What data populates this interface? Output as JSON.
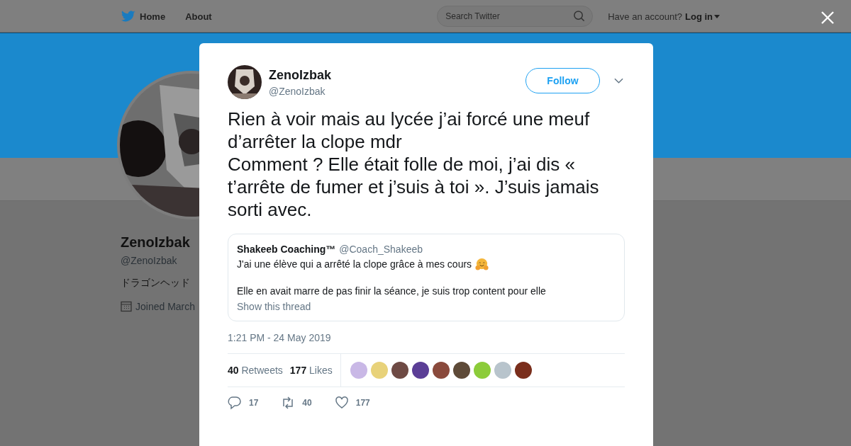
{
  "nav": {
    "items": [
      "Home",
      "About"
    ],
    "search": {
      "placeholder": "Search Twitter"
    },
    "account_prompt": "Have an account?",
    "login": "Log in"
  },
  "profile": {
    "name": "ZenoIzbak",
    "handle": "@ZenoIzbak",
    "bio": "ドラゴンヘッド",
    "joined": "Joined March"
  },
  "tweet": {
    "author": "ZenoIzbak",
    "handle": "@ZenoIzbak",
    "follow": "Follow",
    "text": "Rien à voir mais au lycée j’ai forcé une meuf d’arrêter la clope mdr\nComment ? Elle était folle de moi, j’ai dis « t’arrête de fumer et j’suis à toi ». J’suis jamais sorti avec.",
    "quote": {
      "author": "Shakeeb Coaching™",
      "handle": "@Coach_Shakeeb",
      "lines": [
        "J'ai une élève qui a arrêté la clope grâce à mes cours",
        "Elle en avait marre de pas finir la séance, je suis trop content pour elle"
      ],
      "link": "Show this thread"
    },
    "time": "1:21 PM - 24 May 2019",
    "stats": [
      {
        "count": "40",
        "label": "Retweets"
      },
      {
        "count": "177",
        "label": "Likes"
      }
    ],
    "likers": [
      {
        "color": "#c9b8e6"
      },
      {
        "color": "#e8d27a"
      },
      {
        "color": "#6e4a44"
      },
      {
        "color": "#5b3e96"
      },
      {
        "color": "#8a4a3c"
      },
      {
        "color": "#5e4a38"
      },
      {
        "color": "#8ccc3a"
      },
      {
        "color": "#b8c4cc"
      },
      {
        "color": "#7a2e1c"
      }
    ],
    "actions": [
      {
        "kind": "reply",
        "count": "17"
      },
      {
        "kind": "retweet",
        "count": "40"
      },
      {
        "kind": "like",
        "count": "177"
      }
    ]
  }
}
